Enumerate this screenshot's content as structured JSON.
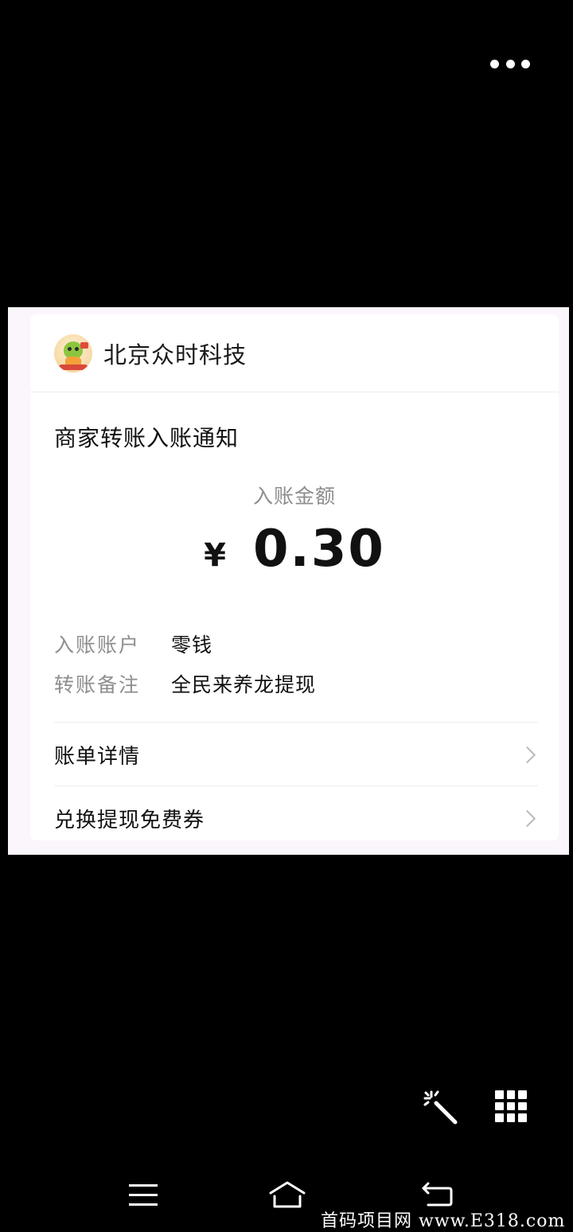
{
  "top_bar": {
    "more_icon": "more-dots-icon"
  },
  "card": {
    "merchant": {
      "name": "北京众时科技",
      "avatar_icon": "dragon-avatar"
    },
    "notice_title": "商家转账入账通知",
    "amount_label": "入账金额",
    "currency_symbol": "¥",
    "amount": "0.30",
    "details": [
      {
        "label": "入账账户",
        "value": "零钱"
      },
      {
        "label": "转账备注",
        "value": "全民来养龙提现"
      }
    ],
    "links": [
      {
        "label": "账单详情"
      },
      {
        "label": "兑换提现免费券"
      }
    ]
  },
  "tools": {
    "magic_icon": "magic-wand-icon",
    "grid_icon": "grid-apps-icon"
  },
  "nav_bar": {
    "menu_icon": "menu-icon",
    "home_icon": "home-icon",
    "back_icon": "back-icon"
  },
  "watermark": "首码项目网 www.E318.com",
  "colors": {
    "background": "#000000",
    "card": "#ffffff",
    "text": "#111111",
    "muted": "#8e8e8e"
  }
}
